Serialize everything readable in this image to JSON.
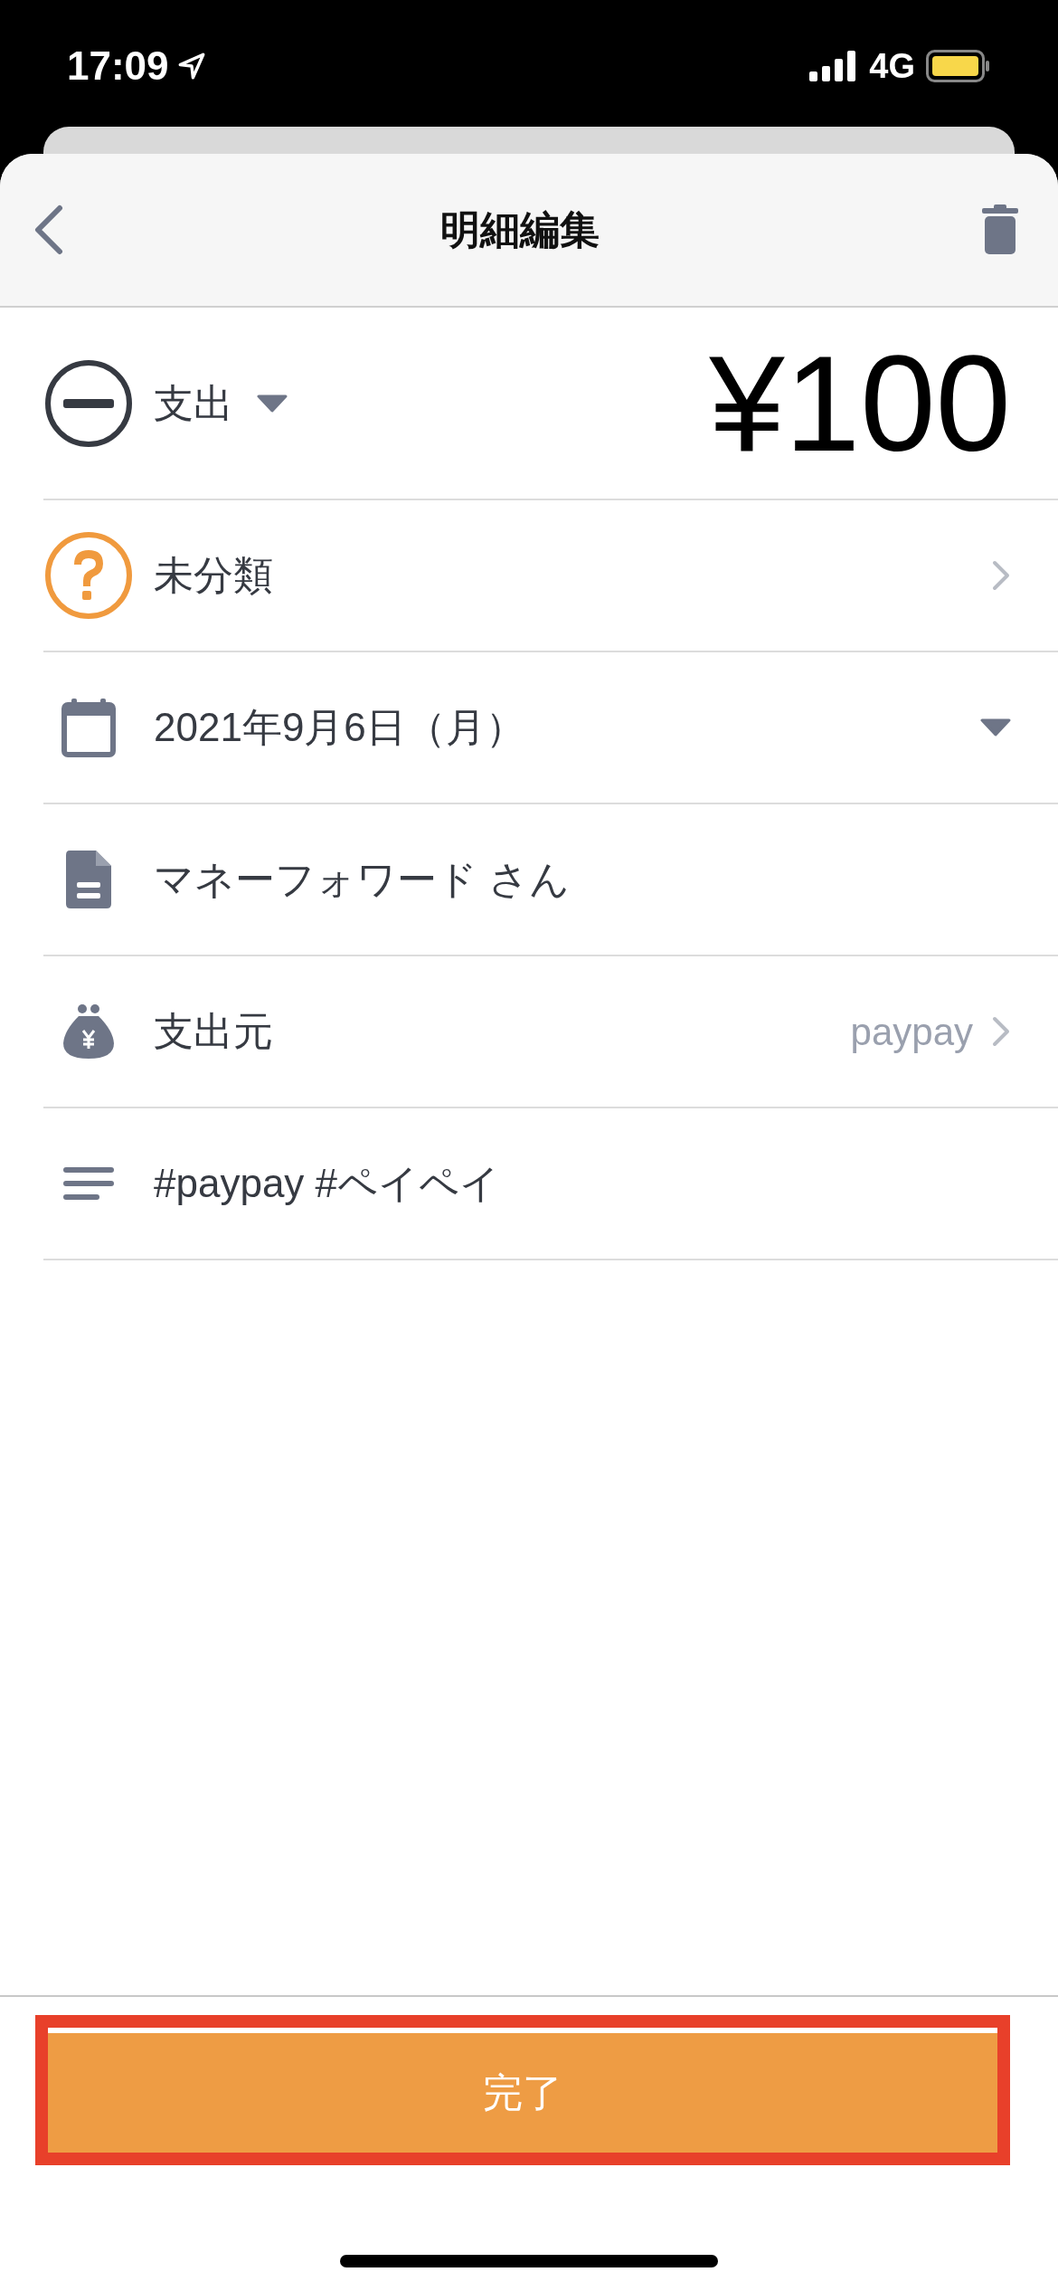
{
  "status_bar": {
    "time": "17:09",
    "network": "4G"
  },
  "header": {
    "title": "明細編集"
  },
  "amount_row": {
    "type_label": "支出",
    "amount": "¥100"
  },
  "rows": [
    {
      "kind": "category",
      "label": "未分類"
    },
    {
      "kind": "date",
      "label": "2021年9月6日（月）"
    },
    {
      "kind": "payee",
      "label": "マネーフォワード さん"
    },
    {
      "kind": "source",
      "label": "支出元",
      "value": "paypay"
    },
    {
      "kind": "memo",
      "label": "#paypay #ペイペイ"
    }
  ],
  "done_button": {
    "label": "完了",
    "highlighted": true
  }
}
